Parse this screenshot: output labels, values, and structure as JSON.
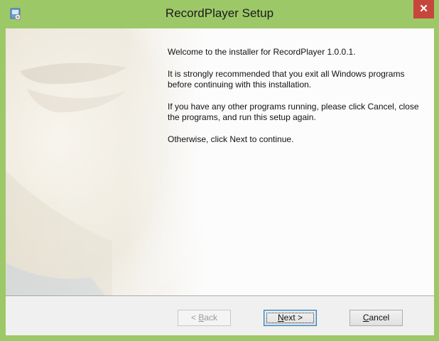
{
  "window": {
    "title": "RecordPlayer Setup",
    "close_symbol": "✕",
    "app_icon": "installer-icon"
  },
  "content": {
    "paragraphs": [
      "Welcome to the installer for RecordPlayer 1.0.0.1.",
      "It is strongly recommended that you exit all Windows programs before continuing with this installation.",
      "If you have any other programs running, please click Cancel, close the programs, and run this setup again.",
      "Otherwise, click Next to continue."
    ]
  },
  "buttons": {
    "back": {
      "prefix": "< ",
      "mnemonic": "B",
      "rest": "ack",
      "enabled": false
    },
    "next": {
      "mnemonic": "N",
      "rest": "ext >",
      "enabled": true
    },
    "cancel": {
      "mnemonic": "C",
      "rest": "ancel",
      "enabled": true
    }
  },
  "colors": {
    "titlebar": "#9dc868",
    "close": "#c7463c"
  }
}
